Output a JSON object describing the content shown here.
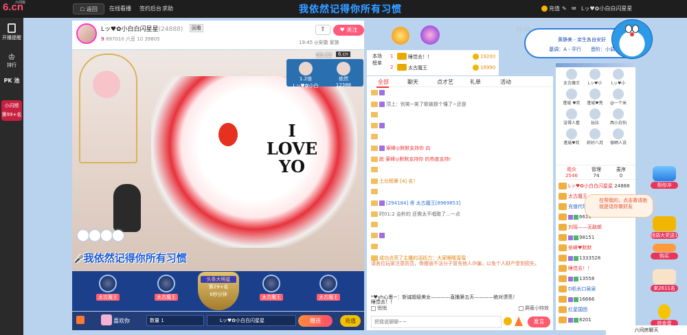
{
  "topbar": {
    "logo_text": "6.cn",
    "logo_sub": "六间房",
    "home_label": "☖ 返回",
    "live_label": "在线看播",
    "sign_label": "签约后台",
    "help_label": "求助",
    "banner_text": "我依然记得你所有习惯",
    "recharge_label": "充值",
    "user_name": "Lッ♥✿小白白闪星星"
  },
  "leftbar": {
    "items": [
      {
        "label": "开播提醒",
        "icon": "tablet-icon"
      },
      {
        "label": "排行",
        "icon": "crown-icon"
      },
      {
        "label": "PK 池",
        "icon": "pk-icon"
      }
    ],
    "flash_title": "小闪榜",
    "flash_rank": "第99+名"
  },
  "room": {
    "host_name": "Lッ♥✿小白白闪星星",
    "room_id": "(24888)",
    "badge": "回看",
    "level": "9",
    "stat_1": "897010 六豆",
    "stat_2": "10",
    "stat_3": "39805",
    "follow_label": "关注",
    "meta": "19:45 ◎安徽 家族"
  },
  "video": {
    "timer": "03:23",
    "timer_logo": "6.cn",
    "mini_users": [
      {
        "name": "Lッ♥✿小白",
        "tag": "1.2倍"
      },
      {
        "name": "依然",
        "tag": "12388"
      }
    ],
    "love_line1": "I",
    "love_line2": "LOVE",
    "love_line3": "YO",
    "caption": "我依然记得你所有习惯"
  },
  "fans": [
    {
      "label": "太古魔王"
    },
    {
      "label": "太古魔王"
    },
    {
      "title": "头条大明星",
      "sub": "第29+名",
      "sub2": "6秒分钟"
    },
    {
      "label": "太古魔王"
    },
    {
      "label": "太古魔王"
    }
  ],
  "giftbar": {
    "like_label": "喜欢你",
    "qty_label": "数量  1",
    "target_label": "Lッ♥✿小白白闪星星",
    "send_label": "赠送",
    "charge_label": "充值"
  },
  "rank": {
    "title": "本场榜单",
    "rows": [
      {
        "n": "1",
        "name": "睡觉去！！",
        "points": "19200"
      },
      {
        "n": "2",
        "name": "太古魔王",
        "points": "16990"
      }
    ]
  },
  "chat": {
    "tabs": [
      "全部",
      "聊天",
      "点才艺",
      "礼单",
      "活动"
    ],
    "messages": [
      {
        "name": "",
        "text": ""
      },
      {
        "name": "",
        "text": "顶上：别笑~笑了歌被那个懂了~还是"
      },
      {
        "name": "",
        "text": ""
      },
      {
        "name": "",
        "text": ""
      },
      {
        "name": "",
        "text": ""
      },
      {
        "name": "",
        "text": "案峰◎默默支持你 向"
      },
      {
        "name": "",
        "text": "脸 案峰◎默默支持你 的热度支持!"
      },
      {
        "name": "",
        "text": ""
      },
      {
        "name": "",
        "text": "土比榜第 [4] 名！"
      },
      {
        "name": "",
        "text": ""
      },
      {
        "name": "",
        "text": "[294184] 将 太古魔王[8969853]"
      },
      {
        "name": "",
        "text": "时01:2 会秒的 还需太不唱歌了...一点"
      },
      {
        "name": "",
        "text": ""
      },
      {
        "name": "",
        "text": ""
      },
      {
        "name": "",
        "text": ""
      },
      {
        "name": "",
        "text": ""
      },
      {
        "name": "",
        "text": "成功点亮了主播的活跃力：大家眼睛溜溜"
      }
    ],
    "notice": "请各位玩家注意防范，骨瘦丽不法分子冒充他人诈骗，以免个人财产受到损失。",
    "marquee": "*♥yh心墨~：新诚超级美女————直播第五天————绝对漂亮！",
    "private_label": "悄悄",
    "hide_label": "屏蔽小特效",
    "to_label": "睡觉去！！",
    "input_placeholder": "把我说聊聊~~",
    "send_label": "发言"
  },
  "members": {
    "top": [
      {
        "name": "太古魔王"
      },
      {
        "name": "Lッ♥小"
      },
      {
        "name": "Lッ♥小"
      },
      {
        "name": "蓬城 ♥欢"
      },
      {
        "name": "蓬城♥亮"
      },
      {
        "name": "@一个米"
      },
      {
        "name": "没得人看"
      },
      {
        "name": "玩拉"
      },
      {
        "name": "两小白怕"
      },
      {
        "name": "蓬城♥欢"
      },
      {
        "name": "舒好八月"
      },
      {
        "name": "很晒人说"
      }
    ],
    "tabs": [
      {
        "label": "观众",
        "count": "2546"
      },
      {
        "label": "管理",
        "count": "74"
      },
      {
        "label": "麦序",
        "count": "0"
      }
    ],
    "list": [
      {
        "name": "Lッ♥✿小白白闪星星",
        "extra": "24888"
      },
      {
        "name": "太古魔王",
        "extra": ""
      },
      {
        "name": "充值代理♥悬荻",
        "extra": ""
      },
      {
        "name": "",
        "extra": "6616"
      },
      {
        "name": "刘瑶——无敌邮",
        "extra": ""
      },
      {
        "name": "",
        "extra": "98151"
      },
      {
        "name": "依峰♥默默",
        "extra": ""
      },
      {
        "name": "",
        "extra": "1333528"
      },
      {
        "name": "睡觉去！！",
        "extra": ""
      },
      {
        "name": "",
        "extra": "13558"
      },
      {
        "name": "D机长口吴泉",
        "extra": ""
      },
      {
        "name": "",
        "extra": "16666"
      },
      {
        "name": "红星国团",
        "extra": ""
      },
      {
        "name": "",
        "extra": "8201"
      }
    ],
    "invite_tip": "在帮我的，点击邀请她就是话你做好友"
  },
  "right_icons": [
    {
      "label": "帮你冲",
      "icon": "plane-icon"
    },
    {
      "label": "钱袋大奖送10万六豆",
      "icon": "moneybag-icon"
    },
    {
      "label": "购买",
      "icon": "shop-icon"
    },
    {
      "label": "来2611名",
      "icon": "cat-icon"
    },
    {
      "label": "抢金蛋",
      "icon": "egg-icon"
    }
  ],
  "dora": {
    "line1": "黄静美 - 余生各自安好",
    "line2": "基调：A - 平行　　音阶：小调",
    "timestamp": "21:05"
  },
  "bottom_room": "六间房聊天"
}
